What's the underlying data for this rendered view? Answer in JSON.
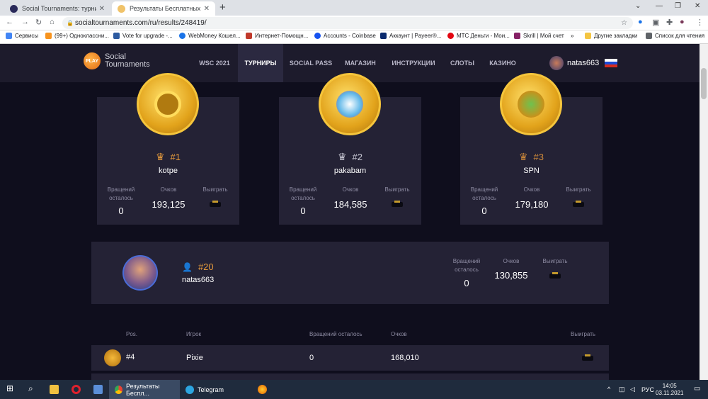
{
  "browser": {
    "tabs": [
      {
        "title": "Social Tournaments: турниры и "
      },
      {
        "title": "Результаты Бесплатных Онлайн"
      }
    ],
    "url": "socialtournaments.com/ru/results/248419/",
    "bookmarks": [
      "Сервисы",
      "(99+) Одноклассни...",
      "Vote for upgrade -...",
      "WebMoney Кошел...",
      "Интернет-Помощн...",
      "Accounts - Coinbase",
      "Аккаунт | Payeer®...",
      "МТС Деньги - Мои...",
      "Skrill | Мой счет",
      "»",
      "Другие закладки",
      "Список для чтения"
    ]
  },
  "site": {
    "logo_line1": "Social",
    "logo_line2": "Tournaments",
    "logo_badge": "PLAY",
    "nav": [
      "WSC 2021",
      "ТУРНИРЫ",
      "SOCIAL PASS",
      "МАГАЗИН",
      "ИНСТРУКЦИИ",
      "СЛОТЫ",
      "КАЗИНО"
    ],
    "username": "natas663"
  },
  "labels": {
    "spins_left": "Вращений осталось",
    "points": "Очков",
    "win": "Выиграть"
  },
  "podium": [
    {
      "rank": "#1",
      "name": "kotpe",
      "spins": "0",
      "points": "193,125"
    },
    {
      "rank": "#2",
      "name": "pakabam",
      "spins": "0",
      "points": "184,585"
    },
    {
      "rank": "#3",
      "name": "SPN",
      "spins": "0",
      "points": "179,180"
    }
  ],
  "my_rank": {
    "rank": "#20",
    "name": "natas663",
    "spins": "0",
    "points": "130,855"
  },
  "table": {
    "headers": {
      "pos": "Pos.",
      "player": "Игрок",
      "spins": "Вращений осталось",
      "points": "Очков",
      "win": "Выиграть"
    },
    "rows": [
      {
        "pos": "#4",
        "player": "Pixie",
        "spins": "0",
        "points": "168,010"
      }
    ]
  },
  "taskbar": {
    "items": [
      "Результаты Беспл...",
      "Telegram"
    ],
    "lang": "РУС",
    "time": "14:05",
    "date": "03.11.2021"
  }
}
